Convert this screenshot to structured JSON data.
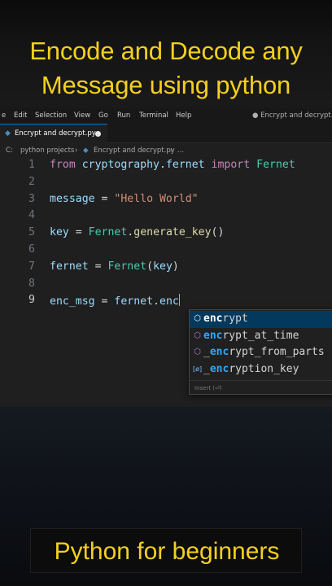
{
  "overlay": {
    "top_line1": "Encode and Decode any",
    "top_line2": "Message using python",
    "bottom": "Python for beginners"
  },
  "menubar": {
    "items": [
      "e",
      "Edit",
      "Selection",
      "View",
      "Go",
      "Run",
      "Terminal",
      "Help"
    ],
    "window_title": "● Encrypt and decrypt.py -"
  },
  "tab": {
    "label": "Encrypt and decrypt.py",
    "icon": "python-file-icon"
  },
  "breadcrumb": {
    "drive": "C:",
    "folder": "python projects",
    "file": "Encrypt and decrypt.py",
    "more": "..."
  },
  "code_lines": [
    {
      "n": "1",
      "tokens": [
        [
          "kw",
          "from"
        ],
        [
          "op",
          " "
        ],
        [
          "id",
          "cryptography"
        ],
        [
          "op",
          "."
        ],
        [
          "id",
          "fernet"
        ],
        [
          "op",
          " "
        ],
        [
          "kw",
          "import"
        ],
        [
          "op",
          " "
        ],
        [
          "cls",
          "Fernet"
        ]
      ]
    },
    {
      "n": "2",
      "tokens": []
    },
    {
      "n": "3",
      "tokens": [
        [
          "id",
          "message"
        ],
        [
          "op",
          " = "
        ],
        [
          "str",
          "\"Hello World\""
        ]
      ]
    },
    {
      "n": "4",
      "tokens": []
    },
    {
      "n": "5",
      "tokens": [
        [
          "id",
          "key"
        ],
        [
          "op",
          " = "
        ],
        [
          "cls",
          "Fernet"
        ],
        [
          "op",
          "."
        ],
        [
          "fn",
          "generate_key"
        ],
        [
          "op",
          "()"
        ]
      ]
    },
    {
      "n": "6",
      "tokens": []
    },
    {
      "n": "7",
      "tokens": [
        [
          "id",
          "fernet"
        ],
        [
          "op",
          " = "
        ],
        [
          "cls",
          "Fernet"
        ],
        [
          "op",
          "("
        ],
        [
          "id",
          "key"
        ],
        [
          "op",
          ")"
        ]
      ]
    },
    {
      "n": "8",
      "tokens": []
    },
    {
      "n": "9",
      "tokens": [
        [
          "id",
          "enc_msg"
        ],
        [
          "op",
          " = "
        ],
        [
          "id",
          "fernet"
        ],
        [
          "op",
          "."
        ],
        [
          "id",
          "enc"
        ]
      ]
    }
  ],
  "suggestions": [
    {
      "match": "enc",
      "rest": "rypt",
      "icon": "method-icon"
    },
    {
      "match": "enc",
      "rest": "rypt_at_time",
      "icon": "method-icon"
    },
    {
      "pre": "_",
      "match": "enc",
      "rest": "rypt_from_parts",
      "icon": "method-icon"
    },
    {
      "pre": "_",
      "match": "enc",
      "rest": "ryption_key",
      "icon": "variable-icon"
    }
  ],
  "suggest_status": "Insert (⏎)",
  "colors": {
    "caption": "#f3d01e",
    "editor_bg": "#1f1f1f",
    "keyword": "#c586c0",
    "class": "#4ec9b0",
    "string": "#ce9178"
  }
}
